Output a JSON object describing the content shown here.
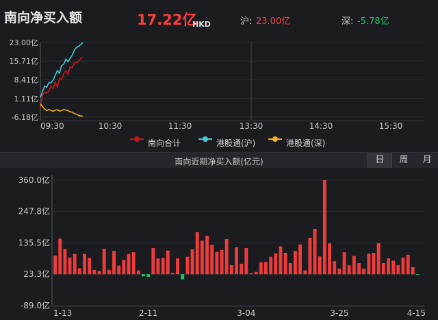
{
  "header": {
    "title": "南向净买入额",
    "total_value": "17.22亿",
    "total_unit": "HKD",
    "sh_label": "沪:",
    "sh_value": "23.00亿",
    "sz_label": "深:",
    "sz_value": "-5.78亿"
  },
  "legend": {
    "south": "南向合计",
    "sh": "港股通(沪)",
    "sz": "港股通(深)"
  },
  "colors": {
    "south": "#c8161d",
    "sh": "#46c8d6",
    "sz": "#f0b020",
    "positive": "#ee3b3b",
    "negative": "#1fc65e"
  },
  "tabs": {
    "title": "南向近期净买入额(亿元)",
    "day": "日",
    "week": "周",
    "month": "月",
    "active": "day"
  },
  "chart_data": [
    {
      "type": "line",
      "y_ticks": [
        "23.00亿",
        "15.71亿",
        "8.41亿",
        "1.11亿",
        "-6.18亿"
      ],
      "x_ticks": [
        "09:30",
        "10:30",
        "11:30",
        "13:30",
        "14:30",
        "15:30"
      ],
      "ylim": [
        -6.18,
        23.0
      ],
      "series": [
        {
          "name": "南向合计",
          "x": [
            "09:30",
            "09:33",
            "09:36",
            "09:39",
            "09:42",
            "09:45",
            "09:48",
            "09:51",
            "09:54",
            "09:57",
            "10:00",
            "10:03",
            "10:06",
            "10:09",
            "10:12",
            "10:15",
            "10:18",
            "10:21",
            "10:24",
            "10:27",
            "10:30"
          ],
          "values": [
            -2.5,
            2.5,
            3.6,
            3.2,
            4.1,
            6.0,
            5.0,
            7.5,
            5.5,
            9.0,
            8.5,
            10.8,
            12.0,
            10.5,
            13.5,
            13.2,
            15.0,
            15.2,
            15.6,
            16.7,
            17.22
          ]
        },
        {
          "name": "港股通(沪)",
          "x": [
            "09:30",
            "09:33",
            "09:36",
            "09:39",
            "09:42",
            "09:45",
            "09:48",
            "09:51",
            "09:54",
            "09:57",
            "10:00",
            "10:03",
            "10:06",
            "10:09",
            "10:12",
            "10:15",
            "10:18",
            "10:21",
            "10:24",
            "10:27",
            "10:30"
          ],
          "values": [
            1.5,
            3.8,
            6.0,
            5.5,
            7.3,
            7.2,
            8.3,
            10.2,
            12.0,
            11.0,
            14.0,
            14.5,
            16.5,
            15.5,
            16.8,
            18.0,
            20.0,
            21.0,
            21.5,
            22.2,
            23.0
          ]
        },
        {
          "name": "港股通(深)",
          "x": [
            "09:30",
            "09:33",
            "09:36",
            "09:39",
            "09:42",
            "09:45",
            "09:48",
            "09:51",
            "09:54",
            "09:57",
            "10:00",
            "10:03",
            "10:06",
            "10:09",
            "10:12",
            "10:15",
            "10:18",
            "10:21",
            "10:24",
            "10:27",
            "10:30"
          ],
          "values": [
            -1.0,
            -2.0,
            -3.0,
            -3.6,
            -3.2,
            -3.5,
            -3.9,
            -3.4,
            -3.3,
            -3.8,
            -3.6,
            -3.2,
            -3.4,
            -3.6,
            -4.1,
            -4.2,
            -4.8,
            -5.0,
            -5.5,
            -5.7,
            -5.78
          ]
        }
      ]
    },
    {
      "type": "bar",
      "y_ticks": [
        "360.0亿",
        "247.8亿",
        "135.5亿",
        "23.3亿",
        "-89.0亿"
      ],
      "x_ticks": [
        "1-13",
        "2-11",
        "3-04",
        "3-25",
        "4-15"
      ],
      "ylim": [
        -89.0,
        360.0
      ],
      "values": [
        90,
        151,
        114,
        83,
        96,
        45,
        96,
        82,
        39,
        35,
        115,
        39,
        107,
        54,
        75,
        96,
        102,
        37,
        16,
        14,
        117,
        80,
        81,
        108,
        29,
        80,
        5,
        86,
        113,
        174,
        144,
        161,
        129,
        103,
        110,
        149,
        56,
        120,
        61,
        117,
        27,
        32,
        66,
        67,
        86,
        98,
        123,
        100,
        63,
        107,
        130,
        37,
        154,
        186,
        87,
        360,
        134,
        70,
        43,
        102,
        55,
        89,
        63,
        43,
        97,
        100,
        135,
        63,
        80,
        72,
        56,
        83,
        93,
        49,
        21
      ]
    }
  ]
}
